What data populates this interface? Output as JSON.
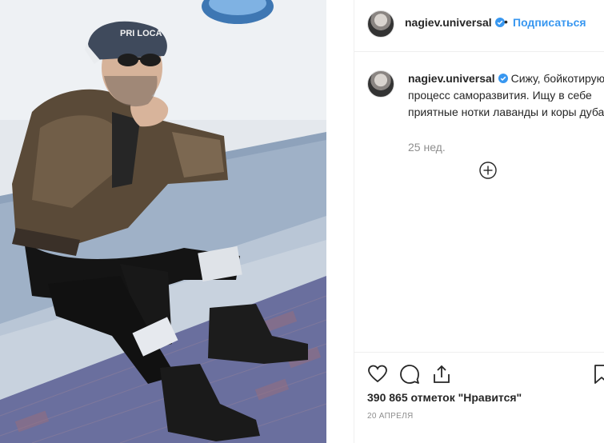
{
  "post": {
    "username": "nagiev.universal",
    "verified": true,
    "separator": "•",
    "follow_label": "Подписаться",
    "caption_username": "nagiev.universal",
    "caption_text": "Сижу, бойкотирую процесс саморазвития. Ищу в себе приятные нотки лаванды и коры дуба.",
    "time_ago": "25 нед.",
    "likes": "390 865 отметок \"Нравится\"",
    "date": "20 АПРЕЛЯ",
    "cap_text": "PRI LOCA"
  },
  "colors": {
    "link": "#3897f0",
    "verified_badge": "#3897f0",
    "text": "#262626",
    "secondary": "#8e8e8e",
    "border": "#efefef"
  },
  "icons": [
    "verified-badge-icon",
    "plus-circle-icon",
    "heart-icon",
    "comment-icon",
    "share-icon",
    "bookmark-icon"
  ]
}
